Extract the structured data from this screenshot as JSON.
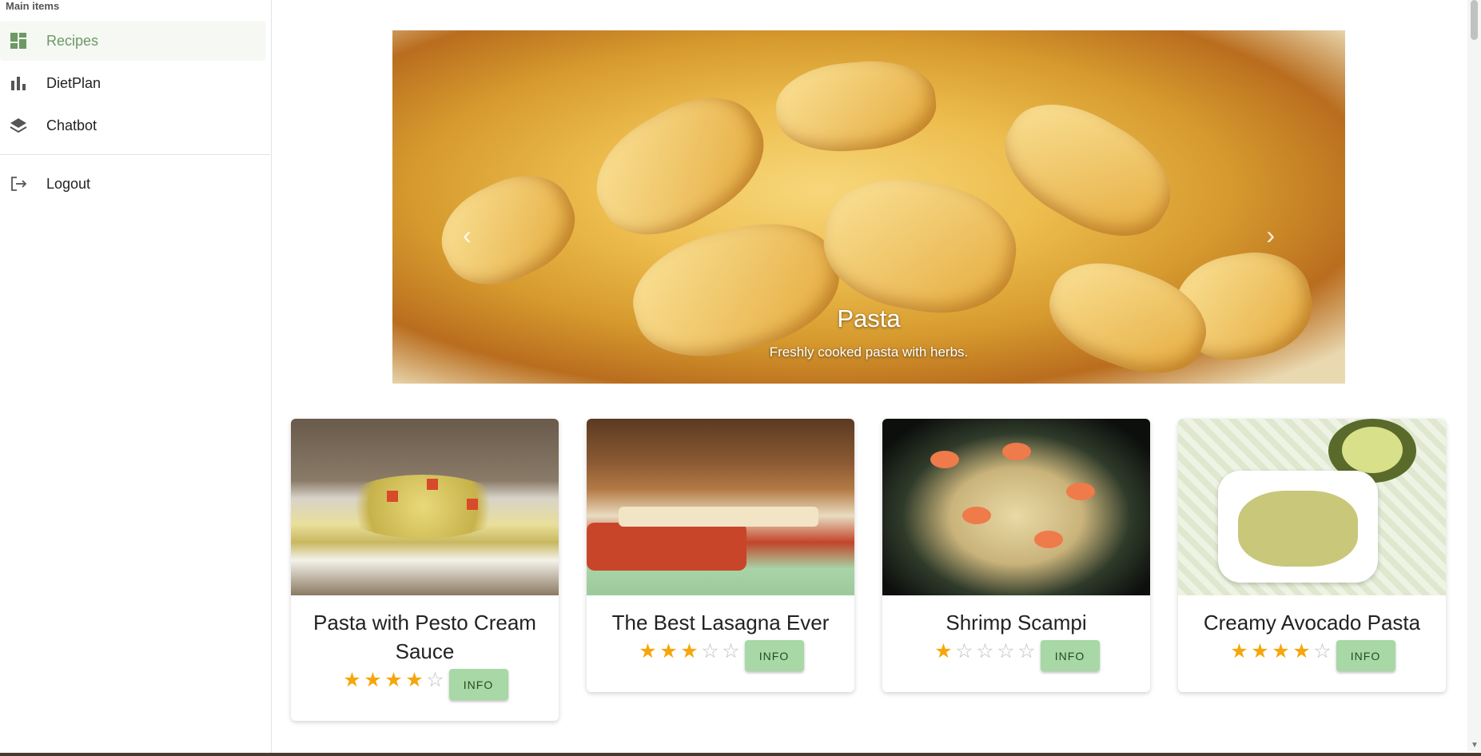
{
  "sidebar": {
    "section_label": "Main items",
    "items": [
      {
        "label": "Recipes",
        "icon": "dashboard-icon",
        "active": true
      },
      {
        "label": "DietPlan",
        "icon": "bar-chart-icon",
        "active": false
      },
      {
        "label": "Chatbot",
        "icon": "layers-icon",
        "active": false
      }
    ],
    "logout": {
      "label": "Logout",
      "icon": "logout-icon"
    }
  },
  "carousel": {
    "title": "Pasta",
    "subtitle": "Freshly cooked pasta with herbs.",
    "prev_icon": "chevron-left-icon",
    "next_icon": "chevron-right-icon",
    "slide_count": 3,
    "active_slide": 1
  },
  "cards": [
    {
      "title": "Pasta with Pesto Cream Sauce",
      "rating": 4,
      "max_rating": 5,
      "button": "INFO"
    },
    {
      "title": "The Best Lasagna Ever",
      "rating": 3,
      "max_rating": 5,
      "button": "INFO"
    },
    {
      "title": "Shrimp Scampi",
      "rating": 1,
      "max_rating": 5,
      "button": "INFO"
    },
    {
      "title": "Creamy Avocado Pasta",
      "rating": 4,
      "max_rating": 5,
      "button": "INFO"
    }
  ],
  "colors": {
    "accent": "#6b9a63",
    "button_bg": "#a8d8a6",
    "star": "#f5a60b"
  }
}
